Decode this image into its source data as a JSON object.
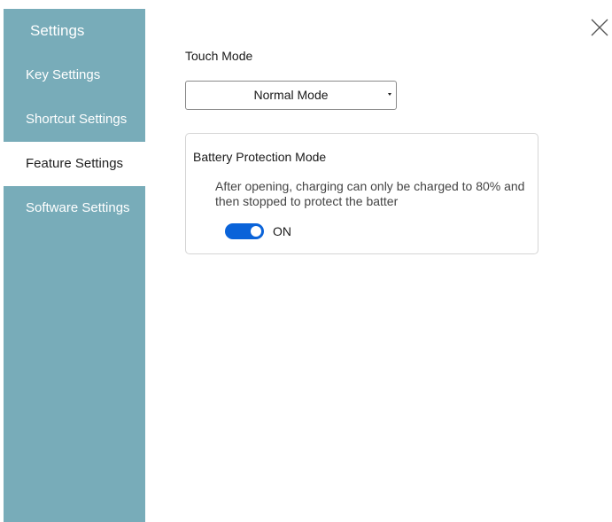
{
  "sidebar": {
    "title": "Settings",
    "items": [
      {
        "label": "Key Settings",
        "active": false
      },
      {
        "label": "Shortcut Settings",
        "active": false
      },
      {
        "label": "Feature Settings",
        "active": true
      },
      {
        "label": "Software Settings",
        "active": false
      }
    ],
    "background_color": "#78acb9"
  },
  "main": {
    "touch_mode": {
      "label": "Touch Mode",
      "selected_value": "Normal Mode"
    },
    "battery_protection": {
      "title": "Battery Protection Mode",
      "description": "After opening, charging can only be charged to 80% and then stopped to protect the batter",
      "toggle_on": true,
      "toggle_label": "ON",
      "toggle_color": "#0a63d9"
    }
  },
  "window": {
    "close_icon": "close-icon"
  }
}
